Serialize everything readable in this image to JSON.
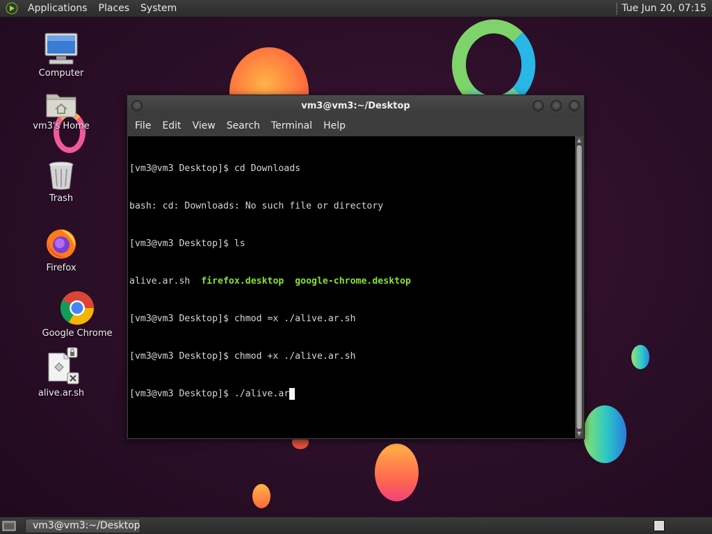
{
  "top_panel": {
    "menus": [
      "Applications",
      "Places",
      "System"
    ],
    "clock": "Tue Jun 20, 07:15"
  },
  "desktop": {
    "icons": [
      {
        "name": "Computer",
        "icon": "computer-icon"
      },
      {
        "name": "vm3's Home",
        "icon": "home-folder-icon"
      },
      {
        "name": "Trash",
        "icon": "trash-icon"
      },
      {
        "name": "Firefox",
        "icon": "firefox-icon"
      },
      {
        "name": "Google Chrome",
        "icon": "chrome-icon"
      },
      {
        "name": "alive.ar.sh",
        "icon": "script-file-icon"
      }
    ]
  },
  "terminal": {
    "title": "vm3@vm3:~/Desktop",
    "menus": [
      "File",
      "Edit",
      "View",
      "Search",
      "Terminal",
      "Help"
    ],
    "lines": [
      "[vm3@vm3 Desktop]$ cd Downloads",
      "bash: cd: Downloads: No such file or directory",
      "[vm3@vm3 Desktop]$ ls",
      "",
      "[vm3@vm3 Desktop]$ chmod =x ./alive.ar.sh",
      "[vm3@vm3 Desktop]$ chmod +x ./alive.ar.sh",
      "[vm3@vm3 Desktop]$ ./alive.ar"
    ],
    "ls_output": {
      "plain": "alive.ar.sh",
      "exec1": "firefox.desktop",
      "exec2": "google-chrome.desktop"
    },
    "colors": {
      "executable": "#8ae234",
      "background": "#000000"
    }
  },
  "bottom_panel": {
    "task": "vm3@vm3:~/Desktop"
  }
}
